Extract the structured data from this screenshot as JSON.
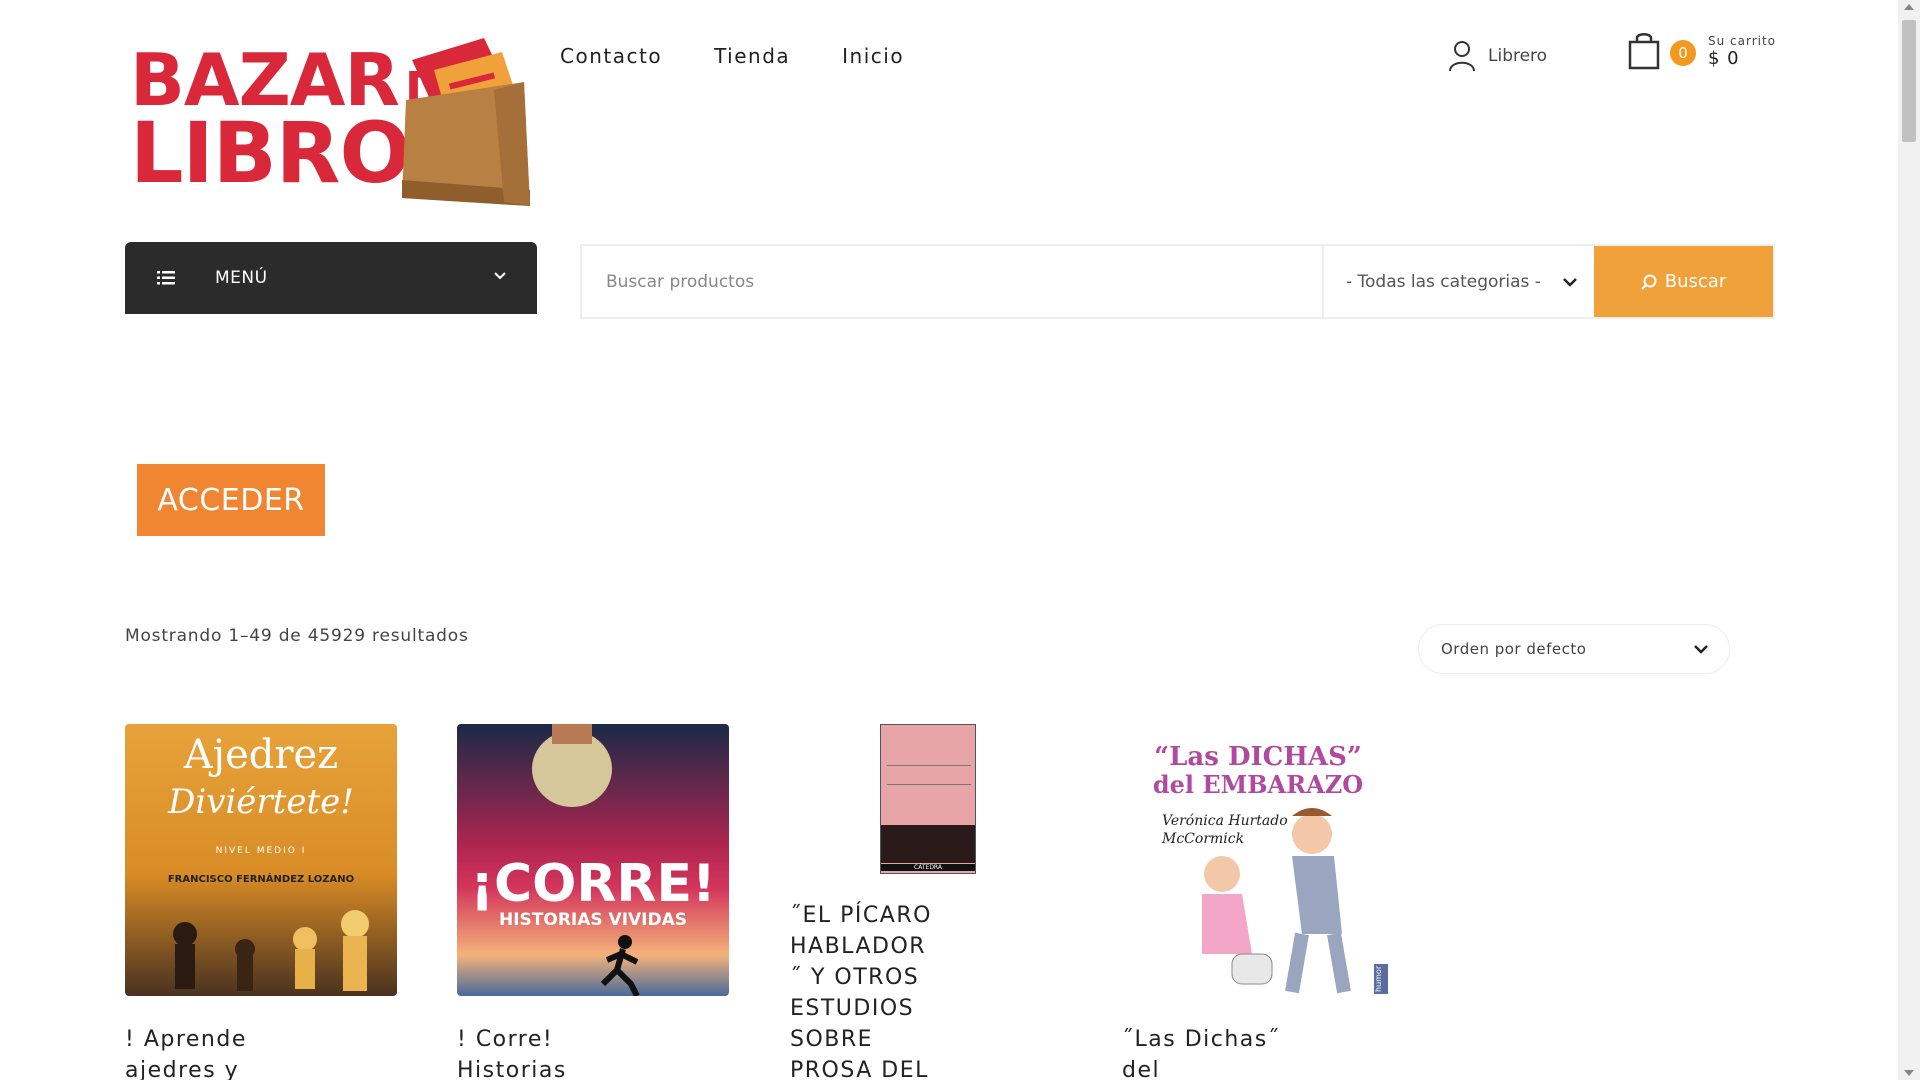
{
  "logo": {
    "line1": "BAZAR",
    "line1_small": "DE",
    "line2": "LIBROS"
  },
  "nav": {
    "items": [
      "Contacto",
      "Tienda",
      "Inicio"
    ]
  },
  "account": {
    "label": "Librero"
  },
  "cart": {
    "count": "0",
    "label": "Su carrito",
    "total": "$ 0"
  },
  "menu": {
    "label": "MENÚ"
  },
  "search": {
    "placeholder": "Buscar productos",
    "category": "- Todas las categorias -",
    "button": "Buscar"
  },
  "login": {
    "label": "ACCEDER"
  },
  "results": {
    "text": "Mostrando 1–49 de 45929 resultados"
  },
  "orderby": {
    "selected": "Orden por defecto"
  },
  "products": [
    {
      "title_l1": "! Aprende",
      "title_l2": "ajedres y",
      "cover_title": "Ajedrez",
      "cover_sub": "Diviértete!",
      "cover_level": "NIVEL MEDIO I",
      "cover_author": "FRANCISCO FERNÁNDEZ LOZANO"
    },
    {
      "title_l1": "! Corre!",
      "title_l2": "Historias",
      "cover_title": "¡CORRE!",
      "cover_sub": "HISTORIAS VIVIDAS"
    },
    {
      "title_l1": "˝EL PÍCARO",
      "title_l2": "HABLADOR",
      "title_l3": "˝ Y OTROS",
      "title_l4": "ESTUDIOS",
      "title_l5": "SOBRE",
      "title_l6": "PROSA DEL",
      "cover_publisher": "CÁTEDRA"
    },
    {
      "title_l1": "˝Las Dichas˝",
      "title_l2": "del",
      "cover_title": "“Las DICHAS”",
      "cover_sub": "del EMBARAZO",
      "cover_author": "Verónica Hurtado McCormick",
      "cover_tag": "humor"
    }
  ],
  "colors": {
    "accent": "#f1a13a",
    "acceder": "#f08632",
    "logo_red": "#d9283a",
    "menu_bg": "#2b2b2b"
  }
}
